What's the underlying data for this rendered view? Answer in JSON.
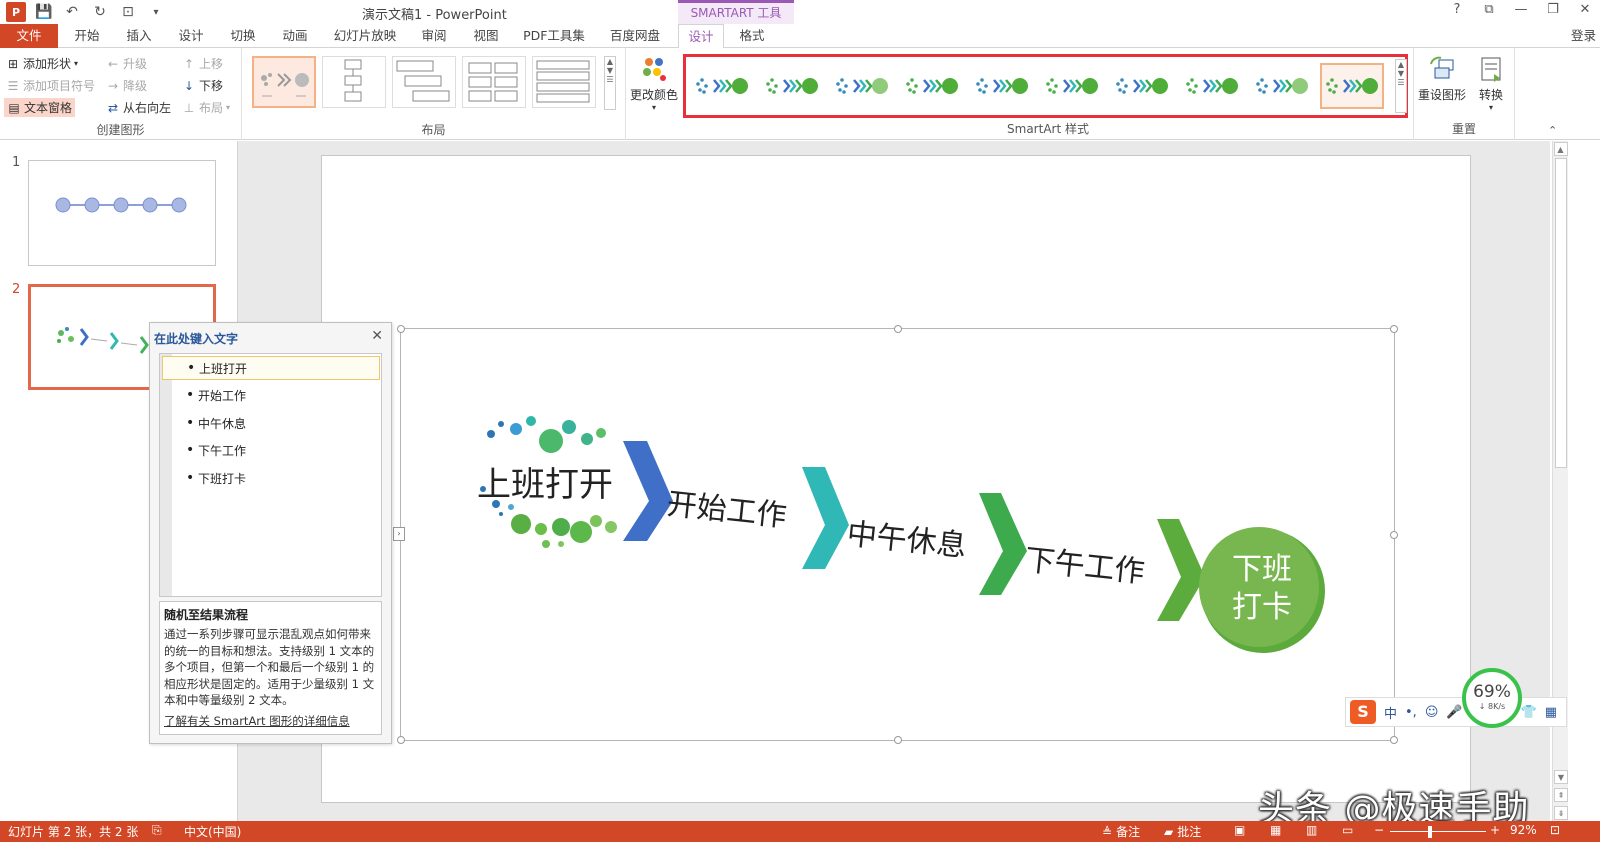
{
  "window": {
    "title": "演示文稿1 - PowerPoint",
    "context_tools": "SMARTART 工具",
    "login": "登录",
    "help": "?",
    "controls": [
      "?",
      "⧉",
      "—",
      "❐",
      "✕"
    ]
  },
  "colors": {
    "file_tab": "#d24726",
    "context_accent": "#9b59b6",
    "gallery_highlight": "#e8303a",
    "status_bar": "#d24726"
  },
  "tabs": [
    {
      "label": "文件",
      "type": "file"
    },
    {
      "label": "开始"
    },
    {
      "label": "插入"
    },
    {
      "label": "设计"
    },
    {
      "label": "切换"
    },
    {
      "label": "动画"
    },
    {
      "label": "幻灯片放映"
    },
    {
      "label": "审阅"
    },
    {
      "label": "视图"
    },
    {
      "label": "PDF工具集"
    },
    {
      "label": "百度网盘"
    },
    {
      "label": "设计",
      "active": true
    },
    {
      "label": "格式"
    }
  ],
  "ribbon": {
    "create_graphic": {
      "label": "创建图形",
      "add_shape": "添加形状",
      "add_bullet": "添加项目符号",
      "text_pane": "文本窗格",
      "promote": "升级",
      "demote": "降级",
      "right_to_left": "从右向左",
      "move_up": "上移",
      "move_down": "下移",
      "layout": "布局"
    },
    "layouts": {
      "label": "布局"
    },
    "change_colors": "更改颜色",
    "smartart_styles": {
      "label": "SmartArt 样式"
    },
    "reset": {
      "label": "重置",
      "reset_graphic": "重设图形",
      "convert": "转换"
    }
  },
  "slides": [
    {
      "number": "1"
    },
    {
      "number": "2",
      "active": true
    }
  ],
  "smartart": {
    "items": [
      "上班打开",
      "开始工作",
      "中午休息",
      "下午工作",
      "下班打卡"
    ],
    "end_line1": "下班",
    "end_line2": "打卡"
  },
  "text_pane": {
    "title": "在此处键入文字",
    "items": [
      "上班打开",
      "开始工作",
      "中午休息",
      "下午工作",
      "下班打卡"
    ],
    "desc_title": "随机至结果流程",
    "desc_body": "通过一系列步骤可显示混乱观点如何带来的统一的目标和想法。支持级别 1 文本的多个项目，但第一个和最后一个级别 1 的相应形状是固定的。适用于少量级别 1 文本和中等量级别 2 文本。",
    "link": "了解有关 SmartArt 图形的详细信息"
  },
  "ime": {
    "lang": "中",
    "punct": "•,",
    "net_percent": "69%",
    "net_speed": "↓ 8K/s"
  },
  "watermark": "头条 @极速手助",
  "status": {
    "slide_info": "幻灯片 第 2 张，共 2 张",
    "language": "中文(中国)",
    "notes": "备注",
    "comments": "批注",
    "zoom": "92%"
  }
}
